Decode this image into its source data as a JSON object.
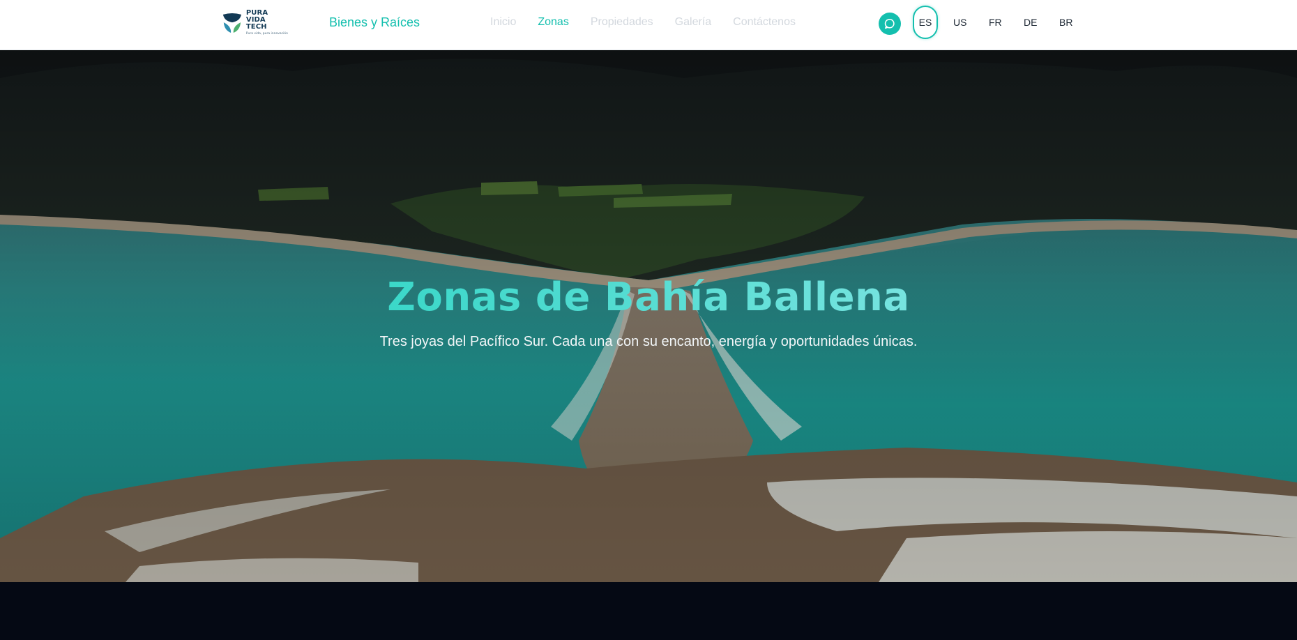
{
  "header": {
    "logo": {
      "line1": "PURA VIDA",
      "line2": "TECH",
      "tagline": "Pura vida, pura innovación"
    },
    "brand": "Bienes y Raíces",
    "nav": [
      {
        "label": "Inicio",
        "active": false
      },
      {
        "label": "Zonas",
        "active": true
      },
      {
        "label": "Propiedades",
        "active": false
      },
      {
        "label": "Galería",
        "active": false
      },
      {
        "label": "Contáctenos",
        "active": false
      }
    ],
    "chat_icon": "chat-bubble-icon",
    "languages": [
      {
        "code": "ES",
        "active": true
      },
      {
        "code": "US",
        "active": false
      },
      {
        "code": "FR",
        "active": false
      },
      {
        "code": "DE",
        "active": false
      },
      {
        "code": "BR",
        "active": false
      }
    ]
  },
  "hero": {
    "title": "Zonas de Bahía Ballena",
    "subtitle": "Tres joyas del Pacífico Sur. Cada una con su encanto, energía y oportunidades únicas."
  },
  "colors": {
    "accent": "#14bfae",
    "nav_inactive": "#d3d8de",
    "footer_bg": "#050914"
  }
}
